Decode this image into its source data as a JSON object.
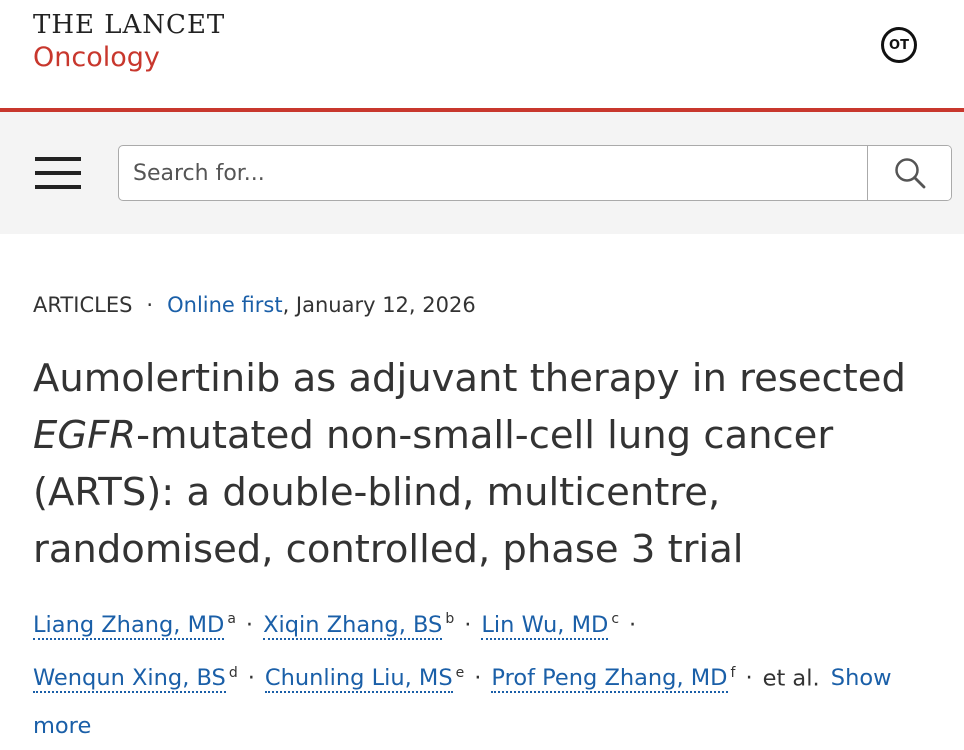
{
  "header": {
    "brand_main": "THE LANCET",
    "brand_sub": "Oncology",
    "badge": "OT"
  },
  "search": {
    "placeholder": "Search for..."
  },
  "article": {
    "type": "ARTICLES",
    "status_link": "Online first",
    "date": ", January 12, 2026",
    "title_part1": "Aumolertinib as adjuvant therapy in resected ",
    "title_italic": "EGFR",
    "title_part2": "-mutated non-small-cell lung cancer (ARTS): a double-blind, multicentre, randomised, controlled, phase 3 trial",
    "authors": [
      {
        "name": "Liang Zhang, MD",
        "aff": "a"
      },
      {
        "name": "Xiqin Zhang, BS",
        "aff": "b"
      },
      {
        "name": "Lin Wu, MD",
        "aff": "c"
      },
      {
        "name": "Wenqun Xing, BS",
        "aff": "d"
      },
      {
        "name": "Chunling Liu, MS",
        "aff": "e"
      },
      {
        "name": "Prof Peng Zhang, MD",
        "aff": "f"
      }
    ],
    "et_al": "et al.",
    "show_more": "Show more",
    "separator": "·"
  },
  "colors": {
    "accent_red": "#c8372d",
    "link_blue": "#1a5fa8",
    "band_gray": "#f4f4f4"
  },
  "icons": {
    "menu": "hamburger-menu-icon",
    "search": "search-icon"
  }
}
